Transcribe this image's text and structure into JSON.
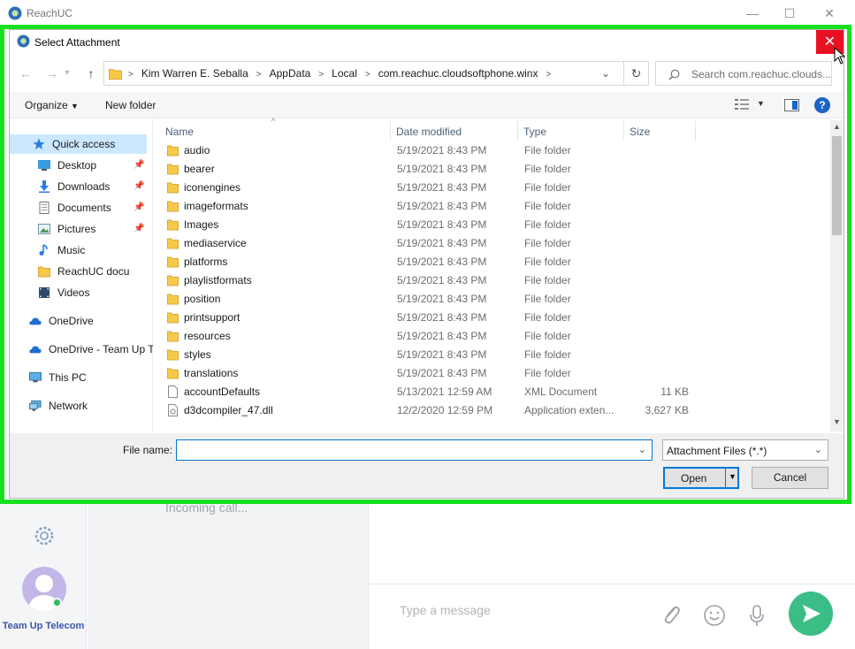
{
  "app": {
    "title": "ReachUC",
    "incoming_text": "Incoming call...",
    "username": "Team Up Telecom",
    "message_placeholder": "Type a message"
  },
  "dialog": {
    "title": "Select Attachment",
    "breadcrumbs": [
      "Kim Warren E. Seballa",
      "AppData",
      "Local",
      "com.reachuc.cloudsoftphone.winx"
    ],
    "search_placeholder": "Search com.reachuc.clouds...",
    "toolbar": {
      "organize": "Organize",
      "new_folder": "New folder"
    },
    "nav": {
      "quick_access": "Quick access",
      "items": [
        {
          "label": "Desktop",
          "pinned": true,
          "icon": "desktop-icon"
        },
        {
          "label": "Downloads",
          "pinned": true,
          "icon": "downloads-icon"
        },
        {
          "label": "Documents",
          "pinned": true,
          "icon": "documents-icon"
        },
        {
          "label": "Pictures",
          "pinned": true,
          "icon": "pictures-icon"
        },
        {
          "label": "Music",
          "pinned": false,
          "icon": "music-icon"
        },
        {
          "label": "ReachUC docu",
          "pinned": false,
          "icon": "folder-icon"
        },
        {
          "label": "Videos",
          "pinned": false,
          "icon": "videos-icon"
        }
      ],
      "onedrive": "OneDrive",
      "onedrive_team": "OneDrive - Team Up T",
      "this_pc": "This PC",
      "network": "Network"
    },
    "columns": {
      "name": "Name",
      "date": "Date modified",
      "type": "Type",
      "size": "Size"
    },
    "files": [
      {
        "name": "audio",
        "date": "5/19/2021 8:43 PM",
        "type": "File folder",
        "size": "",
        "kind": "folder"
      },
      {
        "name": "bearer",
        "date": "5/19/2021 8:43 PM",
        "type": "File folder",
        "size": "",
        "kind": "folder"
      },
      {
        "name": "iconengines",
        "date": "5/19/2021 8:43 PM",
        "type": "File folder",
        "size": "",
        "kind": "folder"
      },
      {
        "name": "imageformats",
        "date": "5/19/2021 8:43 PM",
        "type": "File folder",
        "size": "",
        "kind": "folder"
      },
      {
        "name": "Images",
        "date": "5/19/2021 8:43 PM",
        "type": "File folder",
        "size": "",
        "kind": "folder"
      },
      {
        "name": "mediaservice",
        "date": "5/19/2021 8:43 PM",
        "type": "File folder",
        "size": "",
        "kind": "folder"
      },
      {
        "name": "platforms",
        "date": "5/19/2021 8:43 PM",
        "type": "File folder",
        "size": "",
        "kind": "folder"
      },
      {
        "name": "playlistformats",
        "date": "5/19/2021 8:43 PM",
        "type": "File folder",
        "size": "",
        "kind": "folder"
      },
      {
        "name": "position",
        "date": "5/19/2021 8:43 PM",
        "type": "File folder",
        "size": "",
        "kind": "folder"
      },
      {
        "name": "printsupport",
        "date": "5/19/2021 8:43 PM",
        "type": "File folder",
        "size": "",
        "kind": "folder"
      },
      {
        "name": "resources",
        "date": "5/19/2021 8:43 PM",
        "type": "File folder",
        "size": "",
        "kind": "folder"
      },
      {
        "name": "styles",
        "date": "5/19/2021 8:43 PM",
        "type": "File folder",
        "size": "",
        "kind": "folder"
      },
      {
        "name": "translations",
        "date": "5/19/2021 8:43 PM",
        "type": "File folder",
        "size": "",
        "kind": "folder"
      },
      {
        "name": "accountDefaults",
        "date": "5/13/2021 12:59 AM",
        "type": "XML Document",
        "size": "11 KB",
        "kind": "file"
      },
      {
        "name": "d3dcompiler_47.dll",
        "date": "12/2/2020 12:59 PM",
        "type": "Application exten...",
        "size": "3,627 KB",
        "kind": "dll"
      }
    ],
    "file_name_label": "File name:",
    "file_name_value": "",
    "file_type": "Attachment Files (*.*)",
    "open_label": "Open",
    "cancel_label": "Cancel"
  },
  "colors": {
    "highlight": "#19e01e",
    "close_red": "#e81123",
    "accent_blue": "#0078d7",
    "folder_yellow": "#f7c948",
    "send_green": "#3bbd86"
  }
}
